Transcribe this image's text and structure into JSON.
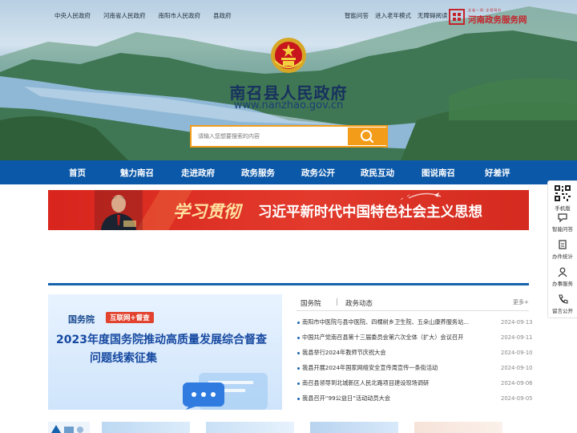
{
  "top_links": [
    "中央人民政府",
    "河南省人民政府",
    "南阳市人民政府",
    "县政府"
  ],
  "top_tools": [
    "智能问答",
    "进入老年模式",
    "无障碍阅读"
  ],
  "service_logo": {
    "name": "河南政务服务网",
    "tagline": "全省一网·全程网办"
  },
  "site": {
    "title": "南召县人民政府",
    "url": "www.nanzhao.gov.cn"
  },
  "search": {
    "placeholder": "请输入您想要搜索的内容"
  },
  "nav": [
    "首页",
    "魅力南召",
    "走进政府",
    "政务服务",
    "政务公开",
    "政民互动",
    "图说南召",
    "好差评"
  ],
  "banner": {
    "title_a": "学习贯彻",
    "title_b": "习近平新时代中国特色社会主义思想"
  },
  "feature": {
    "org": "国务院",
    "tag": "互联网+督查",
    "headline_1": "2023年度国务院推动高质量发展综合督查",
    "headline_2": "问题线索征集"
  },
  "news": {
    "tabs": [
      "国务院",
      "政务动态"
    ],
    "more": "更多+",
    "items": [
      {
        "title": "南阳市中医院与县中医院、四棵树乡卫生院、五朵山康养服务站...",
        "date": "2024-09-13"
      },
      {
        "title": "中国共产党南召县第十三届委员会第六次全体（扩大）会议召开",
        "date": "2024-09-11"
      },
      {
        "title": "我县举行2024年教师节庆祝大会",
        "date": "2024-09-10"
      },
      {
        "title": "我县开展2024年国家网络安全宣传周宣传一条街活动",
        "date": "2024-09-10"
      },
      {
        "title": "南召县领导到北城新区人民北路项目建设现场调研",
        "date": "2024-09-06"
      },
      {
        "title": "我县召开“99公益日”活动动员大会",
        "date": "2024-09-05"
      }
    ]
  },
  "side_panel": [
    "手机版",
    "智能问答",
    "办件统计",
    "办事服务",
    "留言公开"
  ],
  "colors": {
    "nav": "#0b58a8",
    "accent": "#f39c19",
    "banner": "#d8251d"
  }
}
